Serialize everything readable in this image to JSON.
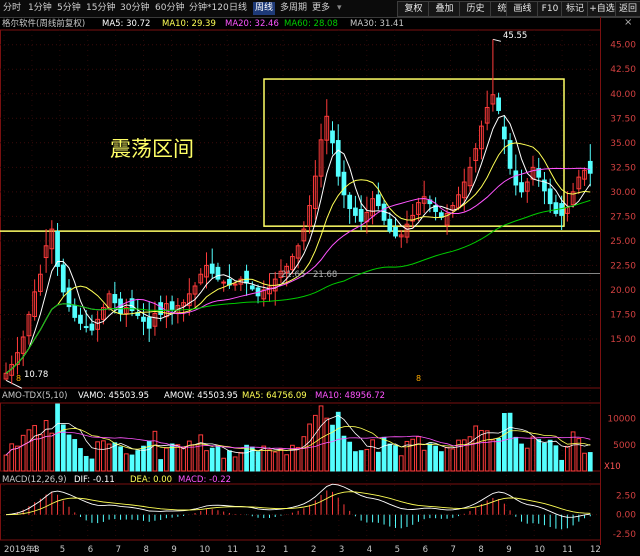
{
  "toolbar": {
    "periods": [
      "分时",
      "1分钟",
      "5分钟",
      "15分钟",
      "30分钟",
      "60分钟",
      "分钟*120",
      "日线",
      "周线",
      "多周期",
      "更多"
    ],
    "active_period": "周线",
    "buttons": [
      "复权",
      "叠加",
      "历史",
      "统计",
      "画线",
      "F10",
      "标记",
      "+自选",
      "返回"
    ]
  },
  "main_legend": {
    "source": "格尔软件(周线前复权)",
    "ma5": "MA5: 30.72",
    "ma10": "MA10: 29.39",
    "ma20": "MA20: 32.46",
    "ma60": "MA60: 28.08",
    "ma30": "MA30: 31.41"
  },
  "annotation": "震荡区间",
  "price_labels": {
    "high": "45.55",
    "low": "10.78",
    "mid_left": "21.65",
    "mid_right": "21.68"
  },
  "marker": "8",
  "vol_legend": {
    "title": "AMO-TDX(5,10)",
    "vamo": "VAMO: 45503.95",
    "amow": "AMOW: 45503.95",
    "ma5": "MA5: 64756.09",
    "ma10": "MA10: 48956.72"
  },
  "vol_unit": "X10",
  "macd_legend": {
    "title": "MACD(12,26,9)",
    "dif": "DIF: -0.11",
    "dea": "DEA: 0.00",
    "macd": "MACD: -0.22"
  },
  "colors": {
    "up": "#ff3b3b",
    "down": "#54ffff",
    "ma5": "#ffffff",
    "ma10": "#ffff55",
    "ma20": "#ff55ff",
    "ma60": "#00cc00",
    "box": "#ffff66"
  },
  "chart_data": [
    {
      "type": "candlestick",
      "title": "格尔软件(周线前复权)",
      "ylim": [
        10,
        46.5
      ],
      "y_ticks": [
        "45.00",
        "42.50",
        "40.00",
        "37.50",
        "35.00",
        "32.50",
        "30.00",
        "27.50",
        "25.00",
        "22.50",
        "20.00",
        "17.50",
        "15.00"
      ],
      "x_labels": [
        "2019年3",
        "4",
        "5",
        "6",
        "7",
        "8",
        "9",
        "10",
        "11",
        "12",
        "1",
        "2",
        "3",
        "4",
        "5",
        "6",
        "7",
        "8",
        "9",
        "10",
        "11",
        "12"
      ],
      "close_approx": [
        11.5,
        12.4,
        13.6,
        15.2,
        17.5,
        19.8,
        21.6,
        24.5,
        26.2,
        22.4,
        19.8,
        18.3,
        17.2,
        16.6,
        16.2,
        15.9,
        17.0,
        18.2,
        19.6,
        18.7,
        17.6,
        18.2,
        17.9,
        17.4,
        16.8,
        16.1,
        17.6,
        17.5,
        18.6,
        18.0,
        18.4,
        18.7,
        19.6,
        20.4,
        21.6,
        22.5,
        21.7,
        21.1,
        20.8,
        20.5,
        20.6,
        21.1,
        20.7,
        20.1,
        19.4,
        20.0,
        20.3,
        21.1,
        21.9,
        22.4,
        23.4,
        24.5,
        26.2,
        28.6,
        31.6,
        35.3,
        37.7,
        35.0,
        31.6,
        29.7,
        28.3,
        27.6,
        27.0,
        27.9,
        29.3,
        28.6,
        27.1,
        26.0,
        25.5,
        25.6,
        26.7,
        27.6,
        28.9,
        29.5,
        28.8,
        28.0,
        27.4,
        27.8,
        28.6,
        29.7,
        31.0,
        32.5,
        34.4,
        36.7,
        38.6,
        39.9,
        38.3,
        35.4,
        32.4,
        30.7,
        30.0,
        31.0,
        32.5,
        31.5,
        30.1,
        28.8,
        27.8,
        27.6,
        28.4,
        30.0,
        31.5,
        32.2,
        31.9
      ],
      "box": {
        "from_price": 26.5,
        "to_price": 41.5
      },
      "support_lines": [
        26.0,
        21.68
      ]
    },
    {
      "type": "bar",
      "title": "AMO-TDX(5,10)",
      "y_ticks": [
        "10000",
        "5000"
      ],
      "ylim": [
        0,
        13000
      ]
    },
    {
      "type": "bar",
      "title": "MACD(12,26,9)",
      "y_ticks": [
        "2.50",
        "0.00",
        "-2.50"
      ],
      "ylim": [
        -3.3,
        4.0
      ]
    }
  ]
}
